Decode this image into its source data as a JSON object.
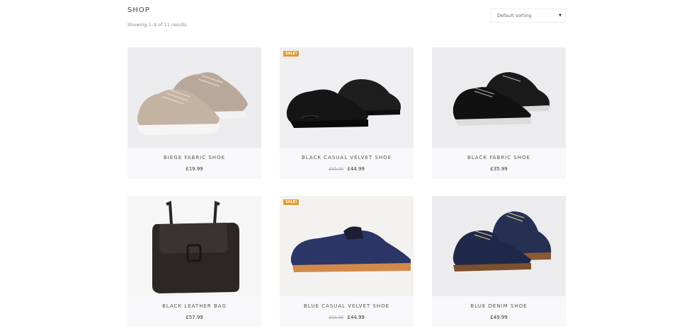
{
  "page": {
    "title": "SHOP",
    "result_count": "Showing 1–9 of 11 results"
  },
  "sorting": {
    "selected": "Default sorting",
    "arrow": "▼"
  },
  "products": [
    {
      "name": "BIEGE FABRIC SHOE",
      "price": "£19.99",
      "old_price": "",
      "sale": ""
    },
    {
      "name": "BLACK CASUAL VELVET SHOE",
      "price": "£44.99",
      "old_price": "£59.99",
      "sale": "SALE!"
    },
    {
      "name": "BLACK FABRIC SHOE",
      "price": "£35.99",
      "old_price": "",
      "sale": ""
    },
    {
      "name": "BLACK LEATHER BAG",
      "price": "£57.99",
      "old_price": "",
      "sale": ""
    },
    {
      "name": "BLUE CASUAL VELVET SHOE",
      "price": "£44.99",
      "old_price": "£59.99",
      "sale": "SALE!"
    },
    {
      "name": "BLUE DENIM SHOE",
      "price": "£49.99",
      "old_price": "",
      "sale": ""
    }
  ],
  "colors": {
    "sale_badge": "#e29a30",
    "card_bg": "#f8f8fa",
    "image_bg": "#ececee"
  }
}
